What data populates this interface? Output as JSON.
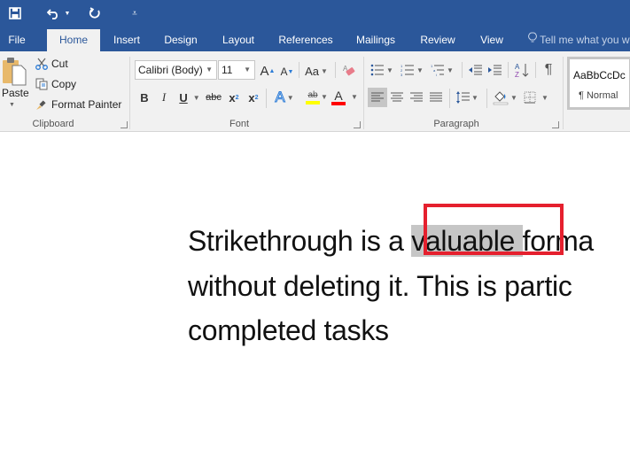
{
  "quick_access": {
    "save_icon": "save-icon",
    "undo_icon": "undo-icon",
    "redo_icon": "redo-icon",
    "customize_icon": "customize-qat-icon"
  },
  "tabs": [
    {
      "label": "File",
      "active": false
    },
    {
      "label": "Home",
      "active": true
    },
    {
      "label": "Insert",
      "active": false
    },
    {
      "label": "Design",
      "active": false
    },
    {
      "label": "Layout",
      "active": false
    },
    {
      "label": "References",
      "active": false
    },
    {
      "label": "Mailings",
      "active": false
    },
    {
      "label": "Review",
      "active": false
    },
    {
      "label": "View",
      "active": false
    }
  ],
  "tell_me": {
    "text": "Tell me what you w",
    "icon": "lightbulb-icon"
  },
  "clipboard": {
    "paste": "Paste",
    "cut": "Cut",
    "copy": "Copy",
    "format_painter": "Format Painter",
    "group_label": "Clipboard"
  },
  "font": {
    "font_name": "Calibri (Body)",
    "font_size": "11",
    "grow": "A",
    "shrink": "A",
    "change_case": "Aa",
    "bold": "B",
    "italic": "I",
    "underline": "U",
    "strikethrough": "abc",
    "subscript": "x",
    "superscript": "x",
    "text_effects": "A",
    "highlight": "ab",
    "font_color": "A",
    "group_label": "Font",
    "highlight_color": "#ffff00",
    "font_color_value": "#ff0000"
  },
  "paragraph": {
    "pilcrow": "¶",
    "group_label": "Paragraph"
  },
  "styles": {
    "preview": "AaBbCcDc",
    "name": "¶ Normal"
  },
  "document": {
    "line1_before": "Strikethrough is a ",
    "line1_selected": "valuable ",
    "line1_after": "forma",
    "line2": "without deleting it. This is partic",
    "line3": "completed tasks"
  },
  "colors": {
    "brand": "#2b579a",
    "highlight_box": "#e5202e",
    "selection": "#c6c6c6"
  }
}
